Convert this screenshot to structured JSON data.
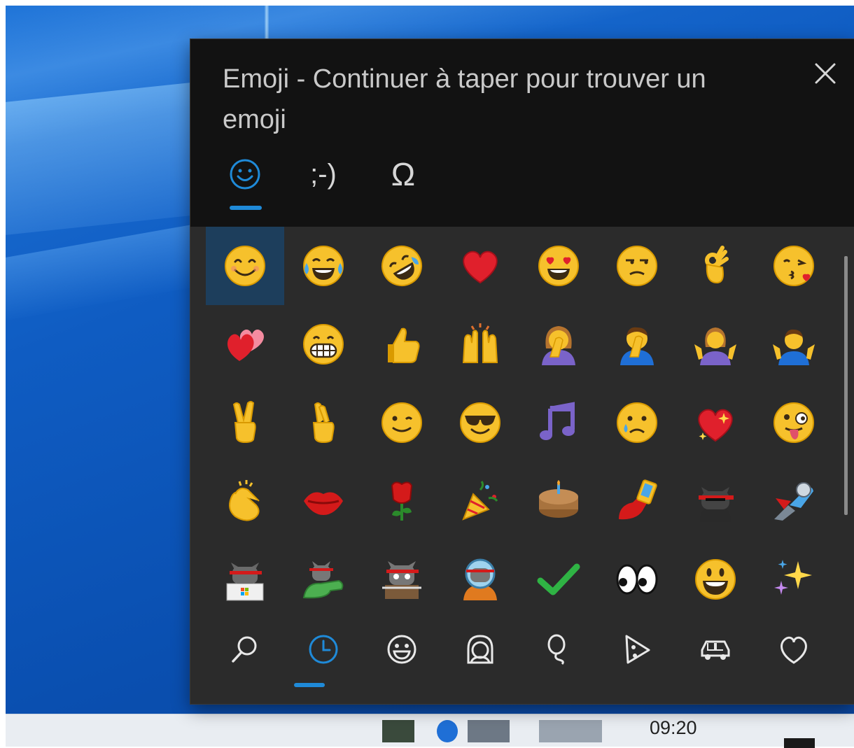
{
  "panel": {
    "title": "Emoji - Continuer à taper pour trouver un emoji",
    "tabs": [
      {
        "id": "emoji",
        "icon": "smiley-outline-icon"
      },
      {
        "id": "kaomoji",
        "label": ";-)"
      },
      {
        "id": "symbols",
        "label": "Ω"
      }
    ],
    "active_tab": "emoji",
    "accent_color": "#1f8ad8",
    "close_icon": "close-icon"
  },
  "emoji_grid": {
    "rows": [
      [
        "smiling-face-icon",
        "tears-of-joy-icon",
        "rolling-laughing-icon",
        "red-heart-icon",
        "heart-eyes-icon",
        "unamused-face-icon",
        "ok-hand-icon",
        "kissing-heart-icon"
      ],
      [
        "two-hearts-icon",
        "grinning-teeth-icon",
        "thumbs-up-icon",
        "raised-hands-icon",
        "woman-facepalm-icon",
        "man-facepalm-icon",
        "woman-shrug-icon",
        "man-shrug-icon"
      ],
      [
        "victory-hand-icon",
        "crossed-fingers-icon",
        "winking-face-icon",
        "sunglasses-face-icon",
        "musical-notes-icon",
        "crying-face-icon",
        "sparkling-heart-icon",
        "zany-face-icon"
      ],
      [
        "clapping-hands-icon",
        "kiss-lips-icon",
        "rose-icon",
        "party-popper-icon",
        "birthday-cake-icon",
        "selfie-icon",
        "ninja-cat-icon",
        "astro-cat-icon"
      ],
      [
        "hacker-cat-icon",
        "dino-cat-icon",
        "stack-cat-icon",
        "diver-cat-icon",
        "check-mark-icon",
        "eyes-icon",
        "grinning-face-icon",
        "sparkles-icon"
      ]
    ],
    "selected_index": 0
  },
  "categories": [
    {
      "id": "search",
      "icon": "search-icon"
    },
    {
      "id": "recent",
      "icon": "clock-icon"
    },
    {
      "id": "smileys",
      "icon": "smiley-icon"
    },
    {
      "id": "people",
      "icon": "person-icon"
    },
    {
      "id": "celebration",
      "icon": "balloon-icon"
    },
    {
      "id": "food",
      "icon": "pizza-icon"
    },
    {
      "id": "travel",
      "icon": "car-icon"
    },
    {
      "id": "symbols",
      "icon": "heart-icon"
    }
  ],
  "active_category": "recent",
  "taskbar": {
    "clock_time": "09:20"
  }
}
